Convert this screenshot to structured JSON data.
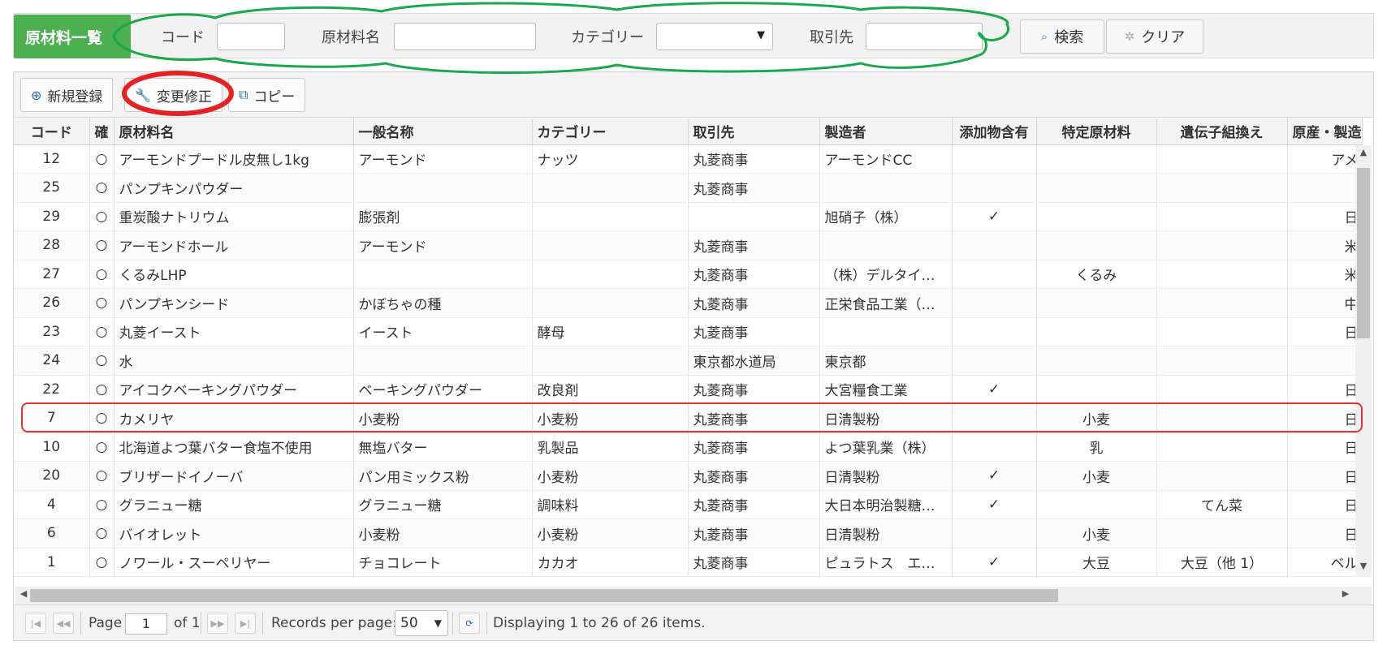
{
  "header": {
    "title": "原材料一覧",
    "code_label": "コード",
    "code_value": "",
    "name_label": "原材料名",
    "name_value": "",
    "category_label": "カテゴリー",
    "category_value": "",
    "supplier_label": "取引先",
    "supplier_value": "",
    "search_label": "検索",
    "clear_label": "クリア"
  },
  "toolbar": {
    "new_label": "新規登録",
    "edit_label": "変更修正",
    "copy_label": "コピー"
  },
  "table": {
    "columns": [
      "コード",
      "確",
      "原材料名",
      "一般名称",
      "カテゴリー",
      "取引先",
      "製造者",
      "添加物含有",
      "特定原材料",
      "遺伝子組換え",
      "原産・製造"
    ],
    "rows": [
      {
        "code": "12",
        "chk": "○",
        "name": "アーモンドプードル皮無し1kg",
        "generic": "アーモンド",
        "category": "ナッツ",
        "supplier": "丸菱商事",
        "maker": "アーモンドCC",
        "additive": "",
        "allergen": "",
        "gmo": "",
        "origin": "アメ"
      },
      {
        "code": "25",
        "chk": "○",
        "name": "パンプキンパウダー",
        "generic": "",
        "category": "",
        "supplier": "丸菱商事",
        "maker": "",
        "additive": "",
        "allergen": "",
        "gmo": "",
        "origin": ""
      },
      {
        "code": "29",
        "chk": "○",
        "name": "重炭酸ナトリウム",
        "generic": "膨張剤",
        "category": "",
        "supplier": "",
        "maker": "旭硝子（株）",
        "additive": "✓",
        "allergen": "",
        "gmo": "",
        "origin": "日"
      },
      {
        "code": "28",
        "chk": "○",
        "name": "アーモンドホール",
        "generic": "アーモンド",
        "category": "",
        "supplier": "丸菱商事",
        "maker": "",
        "additive": "",
        "allergen": "",
        "gmo": "",
        "origin": "米"
      },
      {
        "code": "27",
        "chk": "○",
        "name": "くるみLHP",
        "generic": "",
        "category": "",
        "supplier": "丸菱商事",
        "maker": "（株）デルタイ…",
        "additive": "",
        "allergen": "くるみ",
        "gmo": "",
        "origin": "米"
      },
      {
        "code": "26",
        "chk": "○",
        "name": "パンプキンシード",
        "generic": "かぼちゃの種",
        "category": "",
        "supplier": "丸菱商事",
        "maker": "正栄食品工業（…",
        "additive": "",
        "allergen": "",
        "gmo": "",
        "origin": "中"
      },
      {
        "code": "23",
        "chk": "○",
        "name": "丸菱イースト",
        "generic": "イースト",
        "category": "酵母",
        "supplier": "丸菱商事",
        "maker": "",
        "additive": "",
        "allergen": "",
        "gmo": "",
        "origin": "日"
      },
      {
        "code": "24",
        "chk": "○",
        "name": "水",
        "generic": "",
        "category": "",
        "supplier": "東京都水道局",
        "maker": "東京都",
        "additive": "",
        "allergen": "",
        "gmo": "",
        "origin": ""
      },
      {
        "code": "22",
        "chk": "○",
        "name": "アイコクベーキングパウダー",
        "generic": "ベーキングパウダー",
        "category": "改良剤",
        "supplier": "丸菱商事",
        "maker": "大宮糧食工業",
        "additive": "✓",
        "allergen": "",
        "gmo": "",
        "origin": "日"
      },
      {
        "code": "7",
        "chk": "○",
        "name": "カメリヤ",
        "generic": "小麦粉",
        "category": "小麦粉",
        "supplier": "丸菱商事",
        "maker": "日清製粉",
        "additive": "",
        "allergen": "小麦",
        "gmo": "",
        "origin": "日"
      },
      {
        "code": "10",
        "chk": "○",
        "name": "北海道よつ葉バター食塩不使用",
        "generic": "無塩バター",
        "category": "乳製品",
        "supplier": "丸菱商事",
        "maker": "よつ葉乳業（株）",
        "additive": "",
        "allergen": "乳",
        "gmo": "",
        "origin": "日"
      },
      {
        "code": "20",
        "chk": "○",
        "name": "ブリザードイノーバ",
        "generic": "パン用ミックス粉",
        "category": "小麦粉",
        "supplier": "丸菱商事",
        "maker": "日清製粉",
        "additive": "✓",
        "allergen": "小麦",
        "gmo": "",
        "origin": "日"
      },
      {
        "code": "4",
        "chk": "○",
        "name": "グラニュー糖",
        "generic": "グラニュー糖",
        "category": "調味料",
        "supplier": "丸菱商事",
        "maker": "大日本明治製糖…",
        "additive": "✓",
        "allergen": "",
        "gmo": "てん菜",
        "origin": "日"
      },
      {
        "code": "6",
        "chk": "○",
        "name": "バイオレット",
        "generic": "小麦粉",
        "category": "小麦粉",
        "supplier": "丸菱商事",
        "maker": "日清製粉",
        "additive": "",
        "allergen": "小麦",
        "gmo": "",
        "origin": "日"
      },
      {
        "code": "1",
        "chk": "○",
        "name": "ノワール・スーペリヤー",
        "generic": "チョコレート",
        "category": "カカオ",
        "supplier": "丸菱商事",
        "maker": "ピュラトス　エ…",
        "additive": "✓",
        "allergen": "大豆",
        "gmo": "大豆（他 1）",
        "origin": "ベル"
      }
    ]
  },
  "pager": {
    "page_label": "Page",
    "page_value": "1",
    "of_label": "of 1",
    "rpp_label": "Records per page:",
    "rpp_value": "50",
    "display_text": "Displaying 1 to 26 of 26 items."
  },
  "colors": {
    "title_bg": "#4caf50",
    "annotation_green": "#19a84a",
    "annotation_red": "#e53333"
  },
  "icons": {
    "new": "plus-circle-icon",
    "edit": "wrench-icon",
    "copy": "copy-icon",
    "search": "search-icon",
    "clear": "spinner-icon",
    "refresh": "refresh-icon"
  }
}
